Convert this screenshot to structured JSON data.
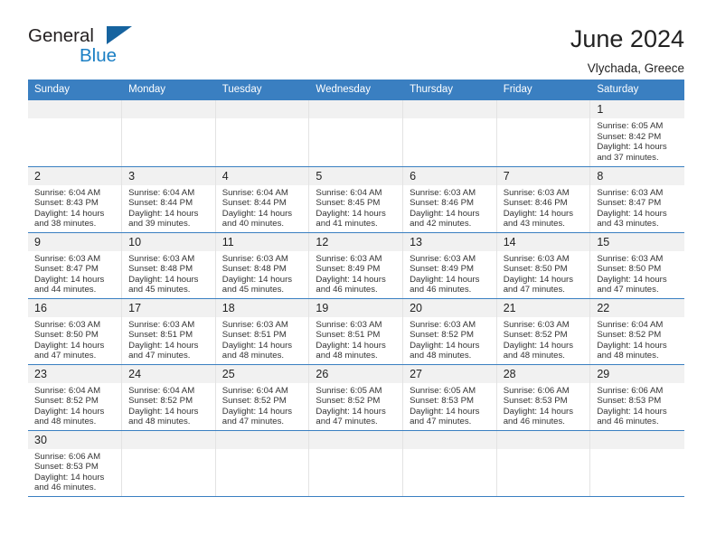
{
  "brand": {
    "name_part1": "General",
    "name_part2": "Blue",
    "accent_color": "#1b7fc4",
    "triangle_color": "#16639f"
  },
  "header": {
    "title": "June 2024",
    "subtitle": "Vlychada, Greece"
  },
  "theme": {
    "header_row_color": "#3a7fc1",
    "daynum_band_color": "#f1f1f1",
    "row_divider_color": "#3a7fc1"
  },
  "weekdays": [
    "Sunday",
    "Monday",
    "Tuesday",
    "Wednesday",
    "Thursday",
    "Friday",
    "Saturday"
  ],
  "weeks": [
    [
      {
        "day": ""
      },
      {
        "day": ""
      },
      {
        "day": ""
      },
      {
        "day": ""
      },
      {
        "day": ""
      },
      {
        "day": ""
      },
      {
        "day": "1",
        "sunrise": "Sunrise: 6:05 AM",
        "sunset": "Sunset: 8:42 PM",
        "daylight": "Daylight: 14 hours and 37 minutes."
      }
    ],
    [
      {
        "day": "2",
        "sunrise": "Sunrise: 6:04 AM",
        "sunset": "Sunset: 8:43 PM",
        "daylight": "Daylight: 14 hours and 38 minutes."
      },
      {
        "day": "3",
        "sunrise": "Sunrise: 6:04 AM",
        "sunset": "Sunset: 8:44 PM",
        "daylight": "Daylight: 14 hours and 39 minutes."
      },
      {
        "day": "4",
        "sunrise": "Sunrise: 6:04 AM",
        "sunset": "Sunset: 8:44 PM",
        "daylight": "Daylight: 14 hours and 40 minutes."
      },
      {
        "day": "5",
        "sunrise": "Sunrise: 6:04 AM",
        "sunset": "Sunset: 8:45 PM",
        "daylight": "Daylight: 14 hours and 41 minutes."
      },
      {
        "day": "6",
        "sunrise": "Sunrise: 6:03 AM",
        "sunset": "Sunset: 8:46 PM",
        "daylight": "Daylight: 14 hours and 42 minutes."
      },
      {
        "day": "7",
        "sunrise": "Sunrise: 6:03 AM",
        "sunset": "Sunset: 8:46 PM",
        "daylight": "Daylight: 14 hours and 43 minutes."
      },
      {
        "day": "8",
        "sunrise": "Sunrise: 6:03 AM",
        "sunset": "Sunset: 8:47 PM",
        "daylight": "Daylight: 14 hours and 43 minutes."
      }
    ],
    [
      {
        "day": "9",
        "sunrise": "Sunrise: 6:03 AM",
        "sunset": "Sunset: 8:47 PM",
        "daylight": "Daylight: 14 hours and 44 minutes."
      },
      {
        "day": "10",
        "sunrise": "Sunrise: 6:03 AM",
        "sunset": "Sunset: 8:48 PM",
        "daylight": "Daylight: 14 hours and 45 minutes."
      },
      {
        "day": "11",
        "sunrise": "Sunrise: 6:03 AM",
        "sunset": "Sunset: 8:48 PM",
        "daylight": "Daylight: 14 hours and 45 minutes."
      },
      {
        "day": "12",
        "sunrise": "Sunrise: 6:03 AM",
        "sunset": "Sunset: 8:49 PM",
        "daylight": "Daylight: 14 hours and 46 minutes."
      },
      {
        "day": "13",
        "sunrise": "Sunrise: 6:03 AM",
        "sunset": "Sunset: 8:49 PM",
        "daylight": "Daylight: 14 hours and 46 minutes."
      },
      {
        "day": "14",
        "sunrise": "Sunrise: 6:03 AM",
        "sunset": "Sunset: 8:50 PM",
        "daylight": "Daylight: 14 hours and 47 minutes."
      },
      {
        "day": "15",
        "sunrise": "Sunrise: 6:03 AM",
        "sunset": "Sunset: 8:50 PM",
        "daylight": "Daylight: 14 hours and 47 minutes."
      }
    ],
    [
      {
        "day": "16",
        "sunrise": "Sunrise: 6:03 AM",
        "sunset": "Sunset: 8:50 PM",
        "daylight": "Daylight: 14 hours and 47 minutes."
      },
      {
        "day": "17",
        "sunrise": "Sunrise: 6:03 AM",
        "sunset": "Sunset: 8:51 PM",
        "daylight": "Daylight: 14 hours and 47 minutes."
      },
      {
        "day": "18",
        "sunrise": "Sunrise: 6:03 AM",
        "sunset": "Sunset: 8:51 PM",
        "daylight": "Daylight: 14 hours and 48 minutes."
      },
      {
        "day": "19",
        "sunrise": "Sunrise: 6:03 AM",
        "sunset": "Sunset: 8:51 PM",
        "daylight": "Daylight: 14 hours and 48 minutes."
      },
      {
        "day": "20",
        "sunrise": "Sunrise: 6:03 AM",
        "sunset": "Sunset: 8:52 PM",
        "daylight": "Daylight: 14 hours and 48 minutes."
      },
      {
        "day": "21",
        "sunrise": "Sunrise: 6:03 AM",
        "sunset": "Sunset: 8:52 PM",
        "daylight": "Daylight: 14 hours and 48 minutes."
      },
      {
        "day": "22",
        "sunrise": "Sunrise: 6:04 AM",
        "sunset": "Sunset: 8:52 PM",
        "daylight": "Daylight: 14 hours and 48 minutes."
      }
    ],
    [
      {
        "day": "23",
        "sunrise": "Sunrise: 6:04 AM",
        "sunset": "Sunset: 8:52 PM",
        "daylight": "Daylight: 14 hours and 48 minutes."
      },
      {
        "day": "24",
        "sunrise": "Sunrise: 6:04 AM",
        "sunset": "Sunset: 8:52 PM",
        "daylight": "Daylight: 14 hours and 48 minutes."
      },
      {
        "day": "25",
        "sunrise": "Sunrise: 6:04 AM",
        "sunset": "Sunset: 8:52 PM",
        "daylight": "Daylight: 14 hours and 47 minutes."
      },
      {
        "day": "26",
        "sunrise": "Sunrise: 6:05 AM",
        "sunset": "Sunset: 8:52 PM",
        "daylight": "Daylight: 14 hours and 47 minutes."
      },
      {
        "day": "27",
        "sunrise": "Sunrise: 6:05 AM",
        "sunset": "Sunset: 8:53 PM",
        "daylight": "Daylight: 14 hours and 47 minutes."
      },
      {
        "day": "28",
        "sunrise": "Sunrise: 6:06 AM",
        "sunset": "Sunset: 8:53 PM",
        "daylight": "Daylight: 14 hours and 46 minutes."
      },
      {
        "day": "29",
        "sunrise": "Sunrise: 6:06 AM",
        "sunset": "Sunset: 8:53 PM",
        "daylight": "Daylight: 14 hours and 46 minutes."
      }
    ],
    [
      {
        "day": "30",
        "sunrise": "Sunrise: 6:06 AM",
        "sunset": "Sunset: 8:53 PM",
        "daylight": "Daylight: 14 hours and 46 minutes."
      },
      {
        "day": ""
      },
      {
        "day": ""
      },
      {
        "day": ""
      },
      {
        "day": ""
      },
      {
        "day": ""
      },
      {
        "day": ""
      }
    ]
  ]
}
